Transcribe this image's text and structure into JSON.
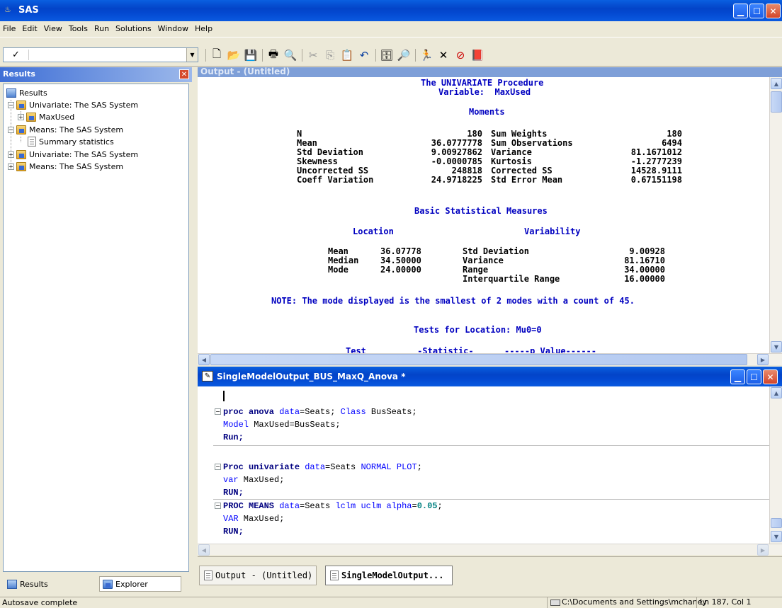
{
  "app": {
    "title": "SAS"
  },
  "menu": [
    "File",
    "Edit",
    "View",
    "Tools",
    "Run",
    "Solutions",
    "Window",
    "Help"
  ],
  "toolbar": {
    "check": "✓",
    "command_value": ""
  },
  "results": {
    "header": "Results",
    "tree": [
      {
        "label": "Results"
      },
      {
        "label": "Univariate:  The SAS System"
      },
      {
        "label": "MaxUsed"
      },
      {
        "label": "Means:  The SAS System"
      },
      {
        "label": "Summary statistics"
      },
      {
        "label": "Univariate:  The SAS System"
      },
      {
        "label": "Means:  The SAS System"
      }
    ],
    "tabs": [
      "Results",
      "Explorer"
    ]
  },
  "output": {
    "title": "Output - (Untitled)",
    "proc_title": "The UNIVARIATE Procedure",
    "variable": "Variable:  MaxUsed",
    "moments_hdr": "Moments",
    "moments": [
      [
        "N",
        "180",
        "Sum Weights",
        "180"
      ],
      [
        "Mean",
        "36.0777778",
        "Sum Observations",
        "6494"
      ],
      [
        "Std Deviation",
        "9.00927862",
        "Variance",
        "81.1671012"
      ],
      [
        "Skewness",
        "-0.0000785",
        "Kurtosis",
        "-1.2777239"
      ],
      [
        "Uncorrected SS",
        "248818",
        "Corrected SS",
        "14528.9111"
      ],
      [
        "Coeff Variation",
        "24.9718225",
        "Std Error Mean",
        "0.67151198"
      ]
    ],
    "basic_hdr": "Basic Statistical Measures",
    "location_hdr": "Location",
    "variability_hdr": "Variability",
    "basic": [
      [
        "Mean",
        "36.07778",
        "Std Deviation",
        "9.00928"
      ],
      [
        "Median",
        "34.50000",
        "Variance",
        "81.16710"
      ],
      [
        "Mode",
        "24.00000",
        "Range",
        "34.00000"
      ],
      [
        "",
        "",
        "Interquartile Range",
        "16.00000"
      ]
    ],
    "note": "NOTE: The mode displayed is the smallest of 2 modes with a count of 45.",
    "tests_hdr": "Tests for Location: Mu0=0",
    "tests_cols": "Test          -Statistic-      -----p Value------"
  },
  "editor": {
    "title": "SingleModelOutput_BUS_MaxQ_Anova *",
    "lines": {
      "l1a": "proc anova",
      "l1b": " data",
      "l1c": "=Seats; ",
      "l1d": "Class",
      "l1e": " BusSeats;",
      "l2a": "Model",
      "l2b": " MaxUsed=BusSeats;",
      "l3": "Run;",
      "l4a": "Proc univariate",
      "l4b": " data",
      "l4c": "=Seats ",
      "l4d": "NORMAL PLOT",
      "l4e": ";",
      "l5a": "var",
      "l5b": " MaxUsed;",
      "l6": "RUN;",
      "l7a": "PROC MEANS",
      "l7b": " data",
      "l7c": "=Seats ",
      "l7d": "lclm uclm alpha",
      "l7e": "=",
      "l7f": "0.05",
      "l7g": ";",
      "l8a": "VAR",
      "l8b": " MaxUsed;",
      "l9": "RUN;"
    }
  },
  "tasks": [
    "Output - (Untitled)",
    "SingleModelOutput..."
  ],
  "status": {
    "left": "Autosave complete",
    "path": "C:\\Documents and Settings\\mchaney",
    "pos": "Ln 187, Col 1"
  }
}
